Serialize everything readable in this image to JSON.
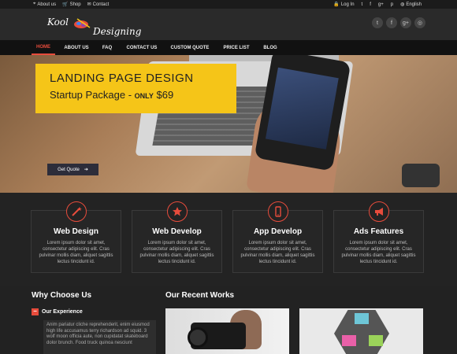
{
  "topbar": {
    "left": [
      {
        "icon": "map-pin-icon",
        "label": "About us"
      },
      {
        "icon": "cart-icon",
        "label": "Shop"
      },
      {
        "icon": "contact-icon",
        "label": "Contact"
      }
    ],
    "right": [
      {
        "icon": "lock-icon",
        "label": "Log In"
      },
      {
        "icon": "twitter-icon",
        "label": ""
      },
      {
        "icon": "facebook-icon",
        "label": ""
      },
      {
        "icon": "google-plus-icon",
        "label": ""
      },
      {
        "icon": "pinterest-icon",
        "label": ""
      },
      {
        "icon": "globe-icon",
        "label": "English"
      }
    ]
  },
  "logo": {
    "word1": "Kool",
    "word2": "Designing"
  },
  "social": [
    "twitter-icon",
    "facebook-icon",
    "google-plus-icon",
    "dribbble-icon"
  ],
  "nav": [
    "HOME",
    "ABOUT US",
    "FAQ",
    "CONTACT US",
    "CUSTOM QUOTE",
    "PRICE LIST",
    "BLOG"
  ],
  "hero": {
    "title": "LANDING PAGE DESIGN",
    "subtitle_prefix": "Startup Package - ",
    "only": "ONLY",
    "price": "$69",
    "cta": "Get Quote",
    "cta_icon": "arrow-right-icon"
  },
  "features": [
    {
      "icon": "magic-wand-icon",
      "title": "Web Design",
      "text": "Lorem ipsum dolor sit amet, consectetur adipiscing elit. Cras pulvinar mollis diam, aliquet sagittis lectus tincidunt id."
    },
    {
      "icon": "star-icon",
      "title": "Web Develop",
      "text": "Lorem ipsum dolor sit amet, consectetur adipiscing elit. Cras pulvinar mollis diam, aliquet sagittis lectus tincidunt id."
    },
    {
      "icon": "mobile-icon",
      "title": "App Develop",
      "text": "Lorem ipsum dolor sit amet, consectetur adipiscing elit. Cras pulvinar mollis diam, aliquet sagittis lectus tincidunt id."
    },
    {
      "icon": "bullhorn-icon",
      "title": "Ads Features",
      "text": "Lorem ipsum dolor sit amet, consectetur adipiscing elit. Cras pulvinar mollis diam, aliquet sagittis lectus tincidunt id."
    }
  ],
  "why": {
    "heading": "Why Choose Us",
    "accordion_title": "Our Experience",
    "accordion_icon": "minus-icon",
    "accordion_text": "Anim pariatur cliche reprehenderit, enim eiusmod high life accusamus terry richardson ad squid. 3 wolf moon officia aute, non cupidatat skateboard dolor brunch. Food truck quinoa nesciunt"
  },
  "works": {
    "heading": "Our Recent Works"
  },
  "colors": {
    "accent": "#e74c3c",
    "promo": "#f5c518",
    "nav_bg": "#111111",
    "body_bg": "#222222"
  }
}
